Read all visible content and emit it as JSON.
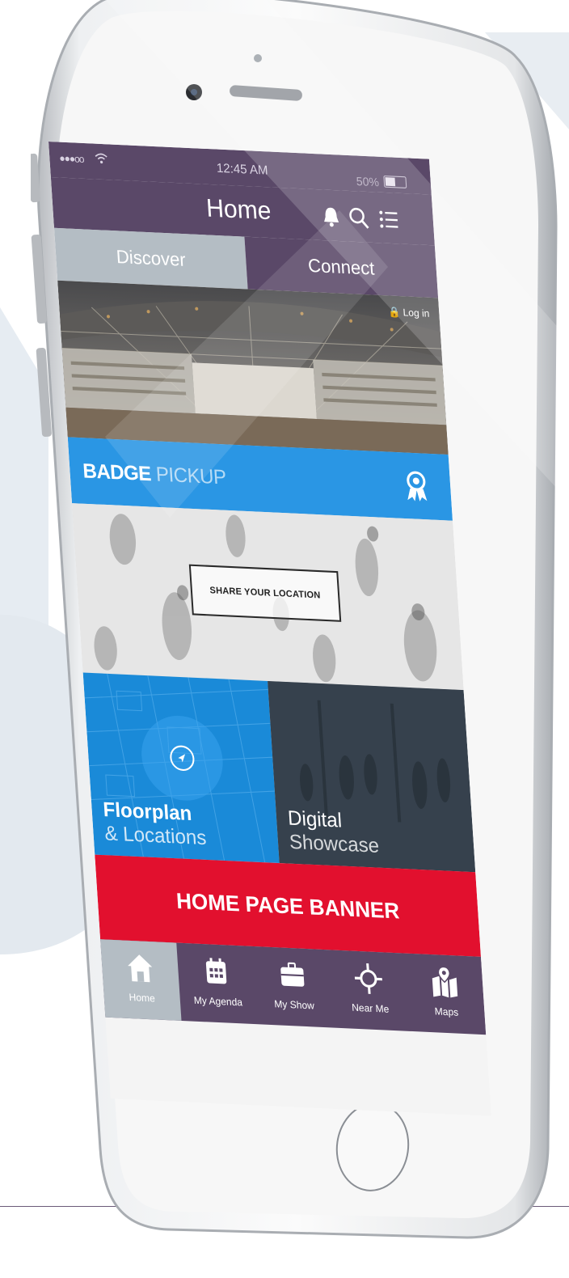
{
  "status_bar": {
    "signal": "●●●oo",
    "time": "12:45 AM",
    "battery_percent": "50%"
  },
  "header": {
    "title": "Home",
    "icons": [
      "bell-icon",
      "search-icon",
      "list-icon"
    ]
  },
  "tabs": [
    {
      "label": "Discover",
      "active": true
    },
    {
      "label": "Connect",
      "active": false
    }
  ],
  "hero": {
    "login_label": "Log in"
  },
  "badge_pickup": {
    "bold": "BADGE",
    "light": " PICKUP",
    "icon": "award-ribbon-icon"
  },
  "share_location": {
    "button_label": "SHARE YOUR LOCATION"
  },
  "tiles": [
    {
      "line1": "Floorplan",
      "line2": "& Locations",
      "icon": "location-arrow-icon"
    },
    {
      "line1": "Digital",
      "line2": "Showcase"
    }
  ],
  "banner": {
    "label": "HOME PAGE BANNER"
  },
  "tab_bar": [
    {
      "label": "Home",
      "icon": "home-icon",
      "active": true
    },
    {
      "label": "My Agenda",
      "icon": "calendar-icon",
      "active": false
    },
    {
      "label": "My Show",
      "icon": "briefcase-icon",
      "active": false
    },
    {
      "label": "Near Me",
      "icon": "crosshair-icon",
      "active": false
    },
    {
      "label": "Maps",
      "icon": "map-pin-icon",
      "active": false
    }
  ],
  "colors": {
    "primary_purple": "#5a4868",
    "tab_grey": "#b4bdc4",
    "badge_blue": "#2a96e4",
    "banner_red": "#e2102e",
    "showcase_slate": "#3a4450"
  }
}
